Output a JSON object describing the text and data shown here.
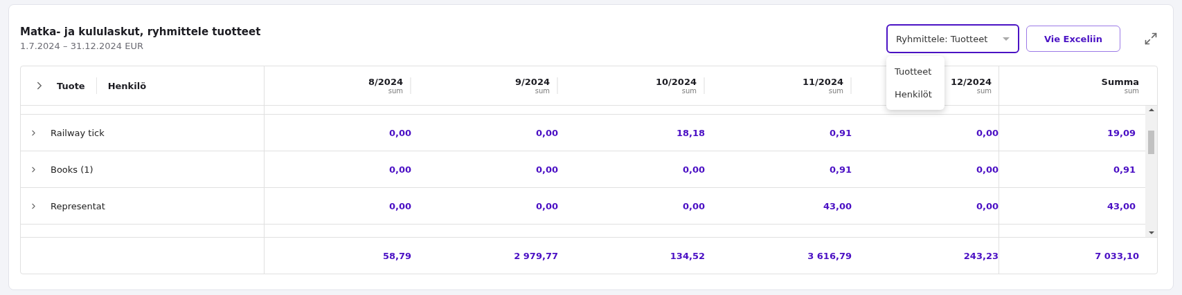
{
  "header": {
    "title": "Matka- ja kululaskut, ryhmittele tuotteet",
    "subtitle": "1.7.2024 – 31.12.2024 EUR"
  },
  "group_select": {
    "value": "Ryhmittele: Tuotteet",
    "expanded": true,
    "options": [
      {
        "label": "Tuotteet",
        "selected": false
      },
      {
        "label": "Henkilöt",
        "selected": false
      }
    ]
  },
  "export_button": "Vie Exceliin",
  "table": {
    "group_columns": [
      "Tuote",
      "Henkilö"
    ],
    "value_columns": [
      {
        "label": "8/2024",
        "sublabel": "sum"
      },
      {
        "label": "9/2024",
        "sublabel": "sum"
      },
      {
        "label": "10/2024",
        "sublabel": "sum"
      },
      {
        "label": "11/2024",
        "sublabel": "sum"
      },
      {
        "label": "12/2024",
        "sublabel": "sum"
      },
      {
        "label": "Summa",
        "sublabel": "sum"
      }
    ],
    "rows": [
      {
        "label": "Railway tick",
        "expanded": false,
        "values": [
          "0,00",
          "0,00",
          "18,18",
          "0,91",
          "0,00",
          "19,09"
        ]
      },
      {
        "label": "Books (1)",
        "expanded": false,
        "values": [
          "0,00",
          "0,00",
          "0,00",
          "0,91",
          "0,00",
          "0,91"
        ]
      },
      {
        "label": "Representat",
        "expanded": false,
        "values": [
          "0,00",
          "0,00",
          "0,00",
          "43,00",
          "0,00",
          "43,00"
        ]
      }
    ],
    "totals": [
      "58,79",
      "2 979,77",
      "134,52",
      "3 616,79",
      "243,23",
      "7 033,10"
    ]
  }
}
